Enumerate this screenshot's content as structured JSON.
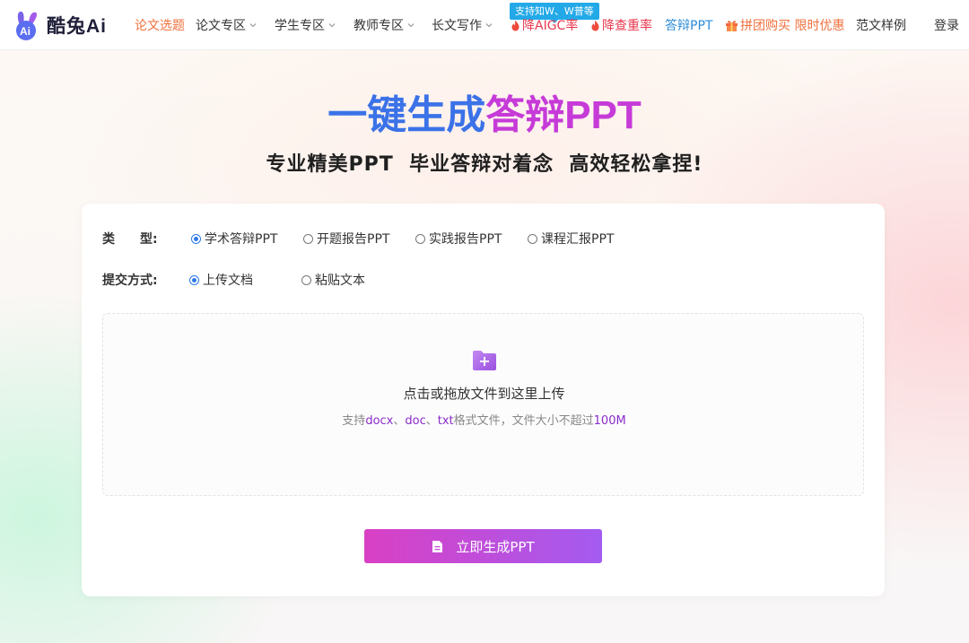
{
  "brand": {
    "name": "酷兔Ai",
    "logo_icon": "rabbit-ai-logo"
  },
  "nav": {
    "items": [
      {
        "label": "论文选题",
        "style": "orange",
        "dropdown": false
      },
      {
        "label": "论文专区",
        "style": "normal",
        "dropdown": true
      },
      {
        "label": "学生专区",
        "style": "normal",
        "dropdown": true
      },
      {
        "label": "教师专区",
        "style": "normal",
        "dropdown": true
      },
      {
        "label": "长文写作",
        "style": "normal",
        "dropdown": true
      },
      {
        "label": "降AIGC率",
        "style": "red",
        "icon": "fire-icon"
      },
      {
        "label": "降查重率",
        "style": "red",
        "icon": "fire-icon"
      },
      {
        "label": "答辩PPT",
        "style": "blue"
      },
      {
        "label": "拼团购买 限时优惠",
        "style": "gift",
        "icon": "gift-icon"
      },
      {
        "label": "范文样例",
        "style": "normal"
      }
    ],
    "badge": "支持知W、W普等",
    "login": "登录"
  },
  "hero": {
    "title_part1": "一键生成",
    "title_part2": "答辩PPT",
    "subtitle": "专业精美PPT  毕业答辩对着念  高效轻松拿捏!"
  },
  "form": {
    "type_label": "类　　型:",
    "types": [
      {
        "label": "学术答辩PPT",
        "selected": true
      },
      {
        "label": "开题报告PPT",
        "selected": false
      },
      {
        "label": "实践报告PPT",
        "selected": false
      },
      {
        "label": "课程汇报PPT",
        "selected": false
      }
    ],
    "submit_label": "提交方式:",
    "submit_modes": [
      {
        "label": "上传文档",
        "selected": true
      },
      {
        "label": "粘贴文本",
        "selected": false
      }
    ],
    "upload": {
      "main_text": "点击或拖放文件到这里上传",
      "hint_prefix": "支持",
      "hint_formats": [
        "docx",
        "doc",
        "txt"
      ],
      "hint_sep": "、",
      "hint_middle": "格式文件，文件大小不超过",
      "hint_size": "100M"
    },
    "generate_button": "立即生成PPT"
  },
  "colors": {
    "accent_blue": "#3b72e8",
    "accent_purple": "#c63bd8",
    "nav_orange": "#f0703c",
    "nav_red": "#e8384f",
    "nav_blue": "#2b8bd8",
    "button_gradient_start": "#d940c4",
    "button_gradient_end": "#a45bf0"
  }
}
